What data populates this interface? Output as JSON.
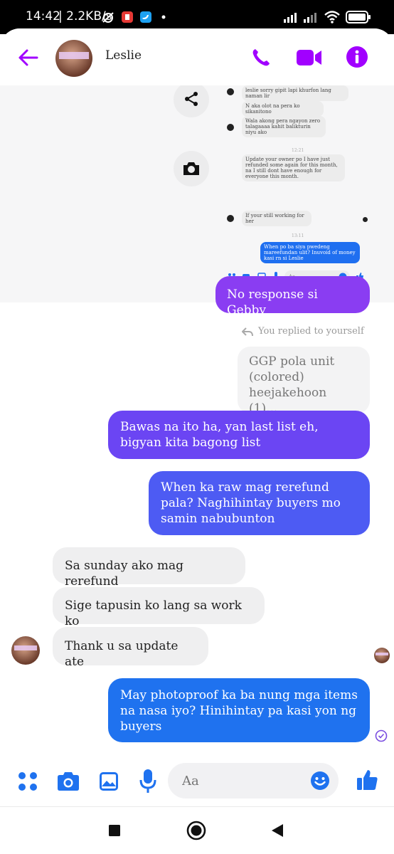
{
  "status_bar": {
    "time": "14:42",
    "speed": "| 2.2KB/s"
  },
  "header": {
    "contact_name": "Leslie",
    "icons": [
      "back-arrow-icon",
      "phone-icon",
      "video-icon",
      "info-icon"
    ]
  },
  "embedded_screenshot": {
    "messages": [
      {
        "text": "leslie sorry gipit lapi khurfon lang naman lir",
        "side": "in"
      },
      {
        "text": "N aka olot na pera ko sikanitono",
        "side": "in"
      },
      {
        "text": "Wala akong pera ngayon zero talagaaaa kahit balikturin niyu ako",
        "side": "in"
      },
      {
        "text": "Update your owner po I have just refunded some again for this month, na I still dont have enough for everyone this month.",
        "side": "in"
      },
      {
        "text": "If your still working for her",
        "side": "in"
      },
      {
        "text": "When po ba siya pwedeng mareefundan ulit? Inuvoid of money kasi rn si Leslie",
        "side": "out"
      }
    ],
    "times": [
      "12:21",
      "13:11"
    ],
    "composer_placeholder": "Aa"
  },
  "messages": [
    {
      "text": "No response si Gebby",
      "side": "out"
    },
    {
      "text": "Bawas na ito ha, yan last list eh, bigyan kita bagong list",
      "side": "out"
    },
    {
      "text": "When ka raw mag rerefund pala? Naghihintay buyers mo samin nabubunton",
      "side": "out"
    },
    {
      "text": "Sa sunday ako mag rerefund",
      "side": "in"
    },
    {
      "text": "Sige tapusin ko lang sa work ko",
      "side": "in"
    },
    {
      "text": "Thank u sa update ate",
      "side": "in"
    },
    {
      "text": "May photoproof ka ba nung mga items na nasa iyo? Hinihintay pa kasi yon ng buyers",
      "side": "out"
    }
  ],
  "reply": {
    "label": "You replied to yourself",
    "preview": "GGP pola unit (colored) heejakehoon (1)..."
  },
  "composer": {
    "placeholder": "Aa",
    "icons": [
      "menu-dots-icon",
      "camera-icon",
      "gallery-icon",
      "mic-icon",
      "emoji-icon",
      "thumbs-up-icon"
    ]
  },
  "colors": {
    "accent": "#a100ff",
    "bubble_purple": "#7a3df0",
    "bubble_blue": "#1f72ef",
    "incoming": "#efeff0"
  }
}
